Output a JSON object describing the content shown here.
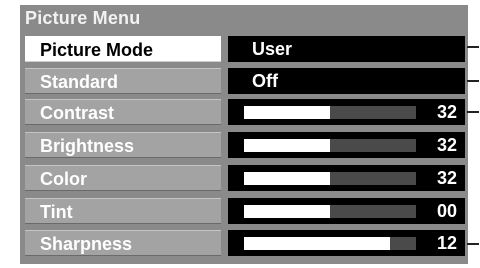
{
  "menu": {
    "title": "Picture Menu",
    "rows": [
      {
        "label": "Picture Mode",
        "type": "text",
        "value": "User",
        "selected": true
      },
      {
        "label": "Standard",
        "type": "text",
        "value": "Off",
        "selected": false
      },
      {
        "label": "Contrast",
        "type": "bar",
        "value": "32",
        "level": 0.5
      },
      {
        "label": "Brightness",
        "type": "bar",
        "value": "32",
        "level": 0.5
      },
      {
        "label": "Color",
        "type": "bar",
        "value": "32",
        "level": 0.5
      },
      {
        "label": "Tint",
        "type": "bar",
        "value": "00",
        "level": 0.5
      },
      {
        "label": "Sharpness",
        "type": "bar",
        "value": "12",
        "level": 0.85
      }
    ]
  },
  "colors": {
    "panel": "#8a8a8a",
    "label_bg": "#a3a3a3",
    "selected_bg": "#ffffff",
    "value_bg": "#000000",
    "bar_fill": "#ffffff"
  }
}
